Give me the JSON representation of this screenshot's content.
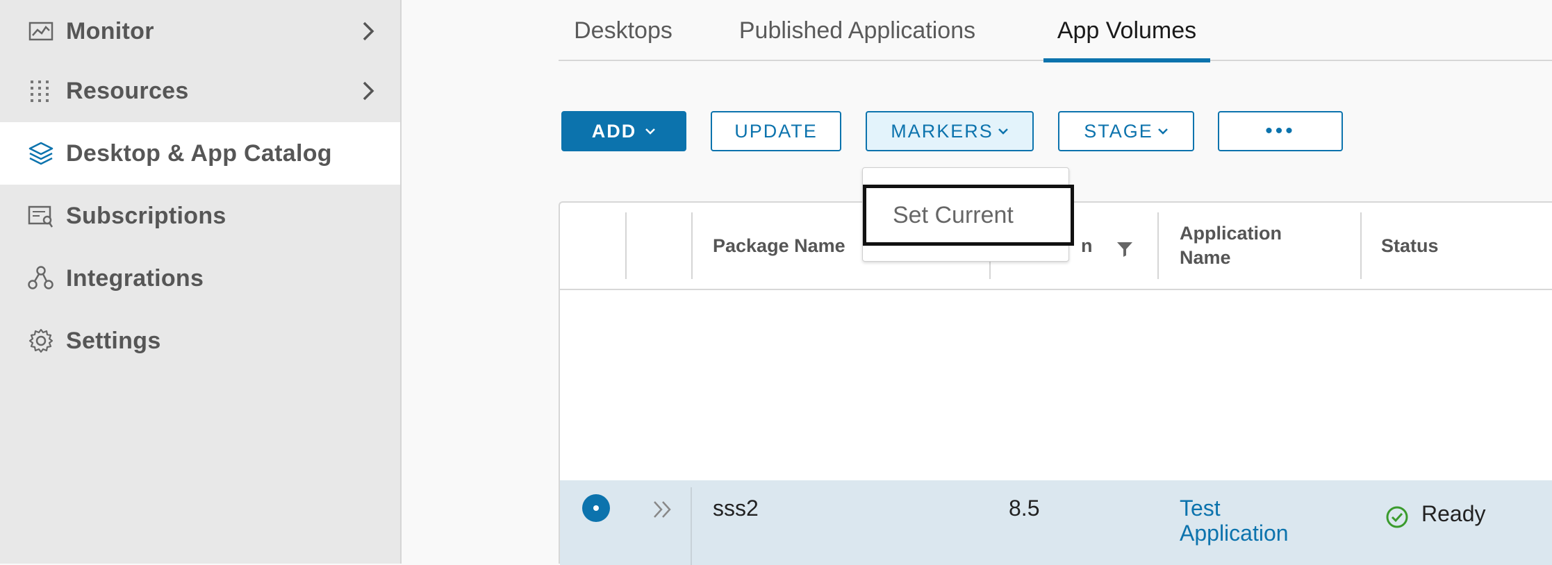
{
  "sidebar": {
    "items": [
      {
        "label": "Monitor",
        "icon": "monitor-icon",
        "has_chevron": true
      },
      {
        "label": "Resources",
        "icon": "resources-grid-icon",
        "has_chevron": true
      },
      {
        "label": "Desktop & App Catalog",
        "icon": "layers-icon",
        "active": true
      },
      {
        "label": "Subscriptions",
        "icon": "subscriptions-icon"
      },
      {
        "label": "Integrations",
        "icon": "integrations-icon"
      },
      {
        "label": "Settings",
        "icon": "gear-icon"
      }
    ]
  },
  "tabs": [
    {
      "label": "Desktops"
    },
    {
      "label": "Published Applications"
    },
    {
      "label": "App Volumes",
      "active": true
    }
  ],
  "toolbar": {
    "add_label": "ADD",
    "update_label": "UPDATE",
    "markers_label": "MARKERS",
    "stage_label": "STAGE",
    "more_label": "•••"
  },
  "markers_menu": {
    "items": [
      {
        "label": "Set Current"
      }
    ]
  },
  "table": {
    "columns": {
      "package_name": "Package Name",
      "version_partial": "n",
      "application_name": "Application Name",
      "status": "Status"
    },
    "rows": [
      {
        "package_name": "sss2",
        "version": "8.5",
        "application_name": "Test Application",
        "status": "Ready"
      }
    ]
  },
  "colors": {
    "accent": "#0c73ad",
    "sidebar_bg": "#e8e8e8",
    "row_selected": "#dbe7ef",
    "status_ok": "#3a9b2d"
  }
}
